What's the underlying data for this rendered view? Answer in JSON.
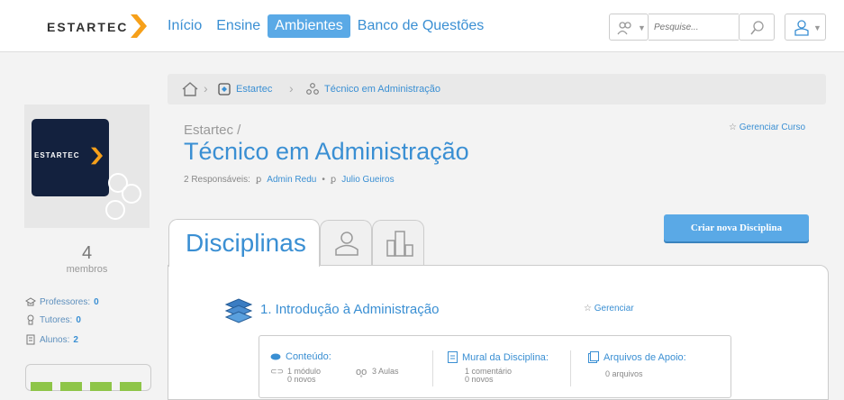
{
  "header": {
    "logo_text": "ESTARTEC",
    "nav": [
      {
        "label": "Início"
      },
      {
        "label": "Ensine"
      },
      {
        "label": "Ambientes",
        "active": true
      },
      {
        "label": "Banco de Questões"
      }
    ],
    "search_placeholder": "Pesquise...",
    "accent_color": "#3a8fd3",
    "active_nav_bg": "#5aa9e6",
    "logo_accent": "#f6a01a"
  },
  "breadcrumb": [
    {
      "label": "Estartec",
      "icon": "environment-icon"
    },
    {
      "label": "Técnico em Administração",
      "icon": "course-icon"
    }
  ],
  "sidebar": {
    "logo_text": "ESTARTEC",
    "member_count": "4",
    "member_label": "membros",
    "stats": [
      {
        "label": "Professores:",
        "value": "0",
        "icon": "professor-icon"
      },
      {
        "label": "Tutores:",
        "value": "0",
        "icon": "tutor-icon"
      },
      {
        "label": "Alunos:",
        "value": "2",
        "icon": "student-icon"
      }
    ]
  },
  "course": {
    "parent": "Estartec /",
    "title": "Técnico em Administração",
    "responsaveis_label": "2 Responsáveis:",
    "responsaveis": [
      "Admin Redu",
      "Julio Gueiros"
    ],
    "manage_label": "Gerenciar Curso"
  },
  "tabs": {
    "main_label": "Disciplinas",
    "icon_tabs": [
      "members-tab-icon",
      "reports-tab-icon"
    ]
  },
  "new_discipline_button": "Criar nova Disciplina",
  "discipline": {
    "title": "1. Introdução à Administração",
    "manage_label": "Gerenciar",
    "content_label": "Conteúdo:",
    "modules_text": "1 módulo",
    "modules_new": "0 novos",
    "lessons_text": "3 Aulas",
    "wall_label": "Mural da Disciplina:",
    "comments_text": "1 comentário",
    "comments_new": "0 novos",
    "files_label": "Arquivos de Apoio:",
    "files_text": "0 arquivos"
  }
}
